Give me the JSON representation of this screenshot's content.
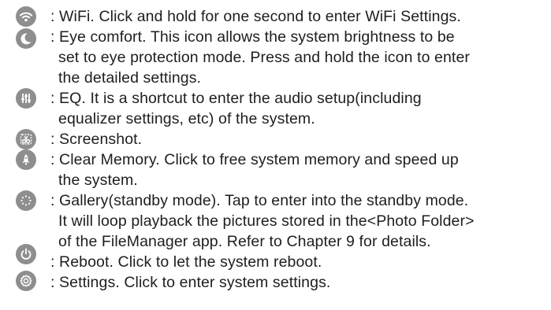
{
  "entries": [
    {
      "icon": "wifi-icon",
      "lines": [
        ": WiFi. Click and hold for one second to enter WiFi Settings."
      ]
    },
    {
      "icon": "eye-comfort-moon-icon",
      "lines": [
        ": Eye comfort. This icon allows the system brightness to be",
        "set to eye protection mode. Press and hold the icon to enter",
        "the detailed settings."
      ]
    },
    {
      "icon": "eq-sliders-icon",
      "lines": [
        ": EQ. It is a shortcut to enter the audio setup(including",
        "equalizer settings, etc) of the system."
      ]
    },
    {
      "icon": "screenshot-scissors-icon",
      "lines": [
        ": Screenshot."
      ]
    },
    {
      "icon": "clear-memory-rocket-icon",
      "lines": [
        ": Clear Memory. Click to free system memory and speed up",
        "the system."
      ]
    },
    {
      "icon": "gallery-standby-icon",
      "lines": [
        ": Gallery(standby mode). Tap to enter into the standby mode.",
        "It will loop playback the pictures stored in the<Photo Folder>",
        "of the FileManager app. Refer to Chapter 9 for details."
      ]
    },
    {
      "icon": "reboot-power-icon",
      "lines": [
        ": Reboot. Click to let the system reboot."
      ]
    },
    {
      "icon": "settings-gear-icon",
      "lines": [
        ": Settings. Click to enter system settings."
      ]
    }
  ]
}
